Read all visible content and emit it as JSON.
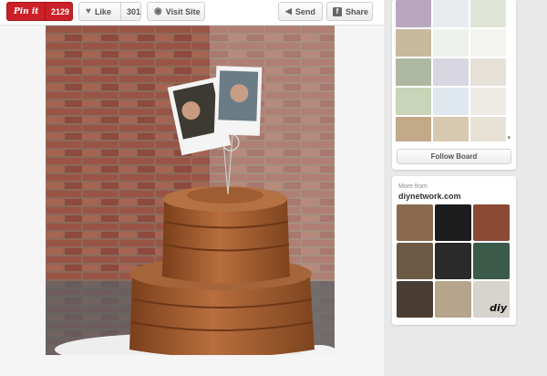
{
  "toolbar": {
    "pinit_label": "Pin it",
    "pinit_count": "2129",
    "like_label": "Like",
    "like_count": "301",
    "visit_label": "Visit Site",
    "send_label": "Send",
    "share_label": "Share"
  },
  "board": {
    "follow_label": "Follow Board",
    "thumb_colors": [
      "#b9a7c2",
      "#e8ecef",
      "#dfe6d8",
      "#c8b89e",
      "#eef2ec",
      "#f4f4f1",
      "#aeb8a0",
      "#d8d6e0",
      "#e5e0d8",
      "#c9d4b8",
      "#dfe7ef",
      "#edeae4",
      "#c2a98a",
      "#d6c9b0",
      "#e8e1d6",
      "#f3f0ea",
      "#d1c3a9",
      "#bcc6d1",
      "#e4d8c6",
      "#cdd5c0"
    ]
  },
  "more_from": {
    "label": "More from",
    "domain": "diynetwork.com",
    "thumb_colors": [
      "#8a6a4e",
      "#1c1c1c",
      "#8c4b35",
      "#6d5a44",
      "#2a2a2a",
      "#3c5a4a",
      "#4a3d33",
      "#b7a48c",
      "#d7d3cd"
    ],
    "logo_text": "diy"
  },
  "icons": {
    "like": "heart-icon",
    "visit": "globe-icon",
    "send": "send-icon",
    "share": "facebook-icon"
  }
}
